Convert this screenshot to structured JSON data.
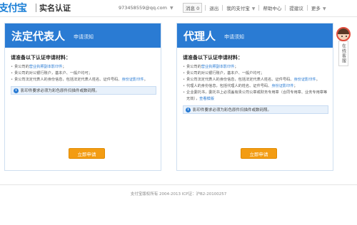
{
  "header": {
    "logo_text": "支付宝",
    "page_name": "实名认证",
    "account_email": "973458559@qq.com",
    "nav": {
      "messages_label": "消息",
      "messages_count": "0",
      "logout": "退出",
      "my_alipay": "我的支付宝",
      "help": "帮助中心",
      "feedback": "提建议",
      "more": "更多"
    }
  },
  "icons": {
    "caret": "▼",
    "info": "i"
  },
  "left_panel": {
    "title": "法定代表人",
    "subtitle": "申请须知",
    "req_title": "请准备以下认证申请材料：",
    "items": [
      {
        "prefix": "贵公司的",
        "link": "营业执照副本影印件",
        "suffix": "；"
      },
      {
        "text": "贵公司的对公银行账户，基本户、一般户均可；"
      },
      {
        "text": "贵公司法定代表人的身份信息，包括法定代表人姓名、证件号码、",
        "link": "身份证影印件",
        "suffix": "。"
      }
    ],
    "notice": "影印件要求必须为彩色原件扫描件或数码照。",
    "button": "立即申请"
  },
  "right_panel": {
    "title": "代理人",
    "subtitle": "申请须知",
    "req_title": "请准备以下认证申请材料：",
    "items": [
      {
        "prefix": "贵公司的",
        "link": "营业执照副本影印件",
        "suffix": "；"
      },
      {
        "text": "贵公司的对公银行账户，基本户、一般户均可；"
      },
      {
        "text": "贵公司法定代表人的身份信息，包括法定代表人姓名、证件号码、",
        "link": "身份证影印件",
        "suffix": "。"
      },
      {
        "text": "代理人的身份信息，包括代理人的姓名、证件号码、",
        "link": "身份证影印件",
        "suffix": "；"
      },
      {
        "text": "企业委托书，委托书上必须盖有贵公司公章或财务专用章（合同专用章、业务专用章等无效），",
        "link": "查看模版",
        "suffix": ""
      }
    ],
    "notice": "影印件要求必须为彩色原件扫描件或数码照。",
    "button": "立即申请"
  },
  "side_widget": {
    "label": "在线客服"
  },
  "footer": {
    "copyright": "支付宝版权所有 2004-2013 ICP证：沪B2-20100257"
  }
}
